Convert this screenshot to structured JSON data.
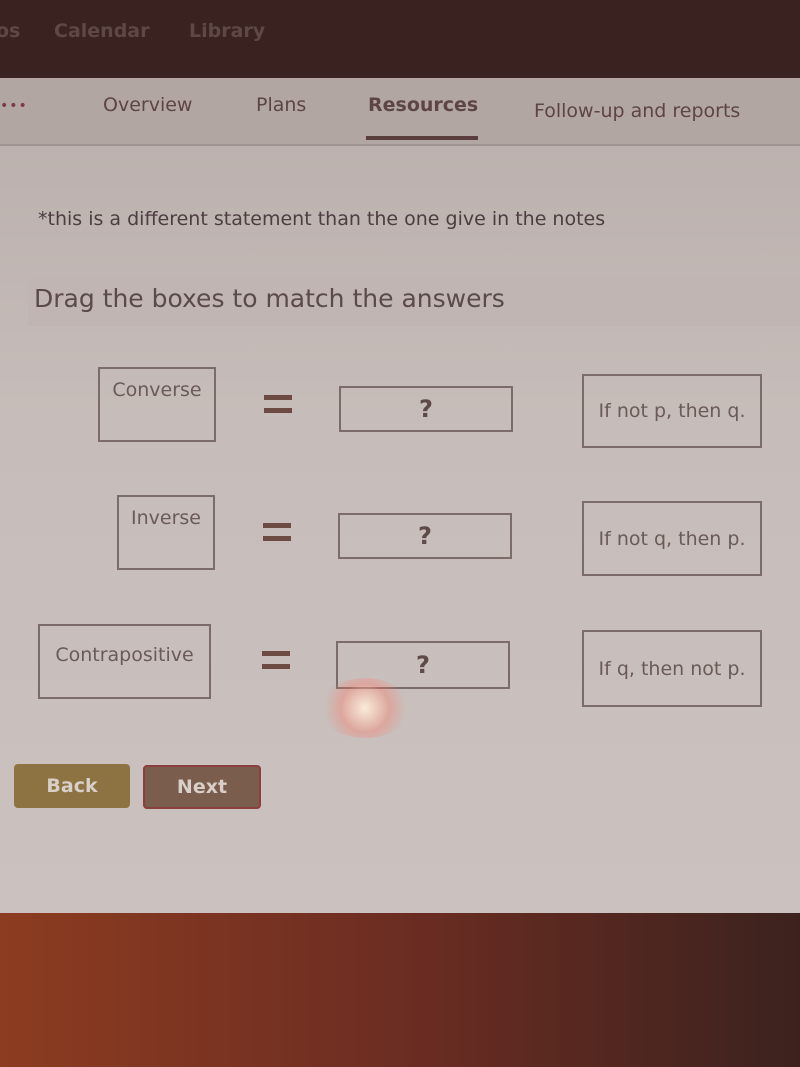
{
  "top_nav": {
    "items": [
      {
        "label": "os"
      },
      {
        "label": "Calendar"
      },
      {
        "label": "Library"
      }
    ]
  },
  "tabs": {
    "more_label": "•••",
    "items": [
      {
        "label": "Overview",
        "active": false
      },
      {
        "label": "Plans",
        "active": false
      },
      {
        "label": "Resources",
        "active": true
      },
      {
        "label": "Follow-up and reports",
        "active": false
      }
    ]
  },
  "content": {
    "note": "*this is a different statement than the one give in the notes",
    "prompt": "Drag the boxes to match the answers",
    "rows": [
      {
        "term": "Converse",
        "equals": "=",
        "drop_placeholder": "?",
        "answer": "If not p, then q."
      },
      {
        "term": "Inverse",
        "equals": "=",
        "drop_placeholder": "?",
        "answer": "If not q, then p."
      },
      {
        "term": "Contrapositive",
        "equals": "=",
        "drop_placeholder": "?",
        "answer": "If q, then not p."
      }
    ]
  },
  "buttons": {
    "back": "Back",
    "next": "Next"
  },
  "colors": {
    "back_button": "#8e7342",
    "next_button": "#7b5d4d",
    "active_tab_underline": "#5a3e3e"
  }
}
